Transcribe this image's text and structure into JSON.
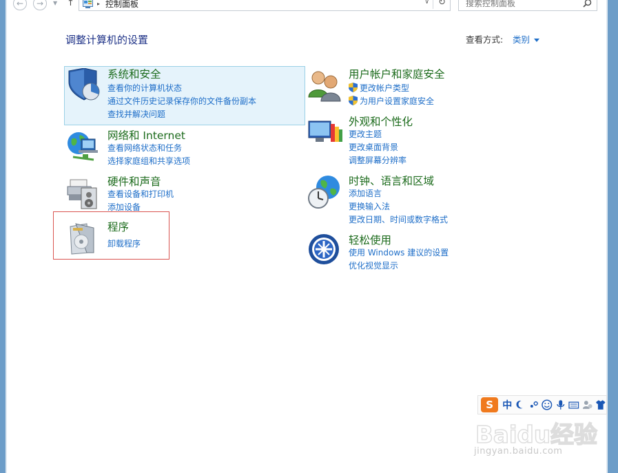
{
  "address_bar": {
    "back_glyph": "←",
    "forward_glyph": "→",
    "up_glyph": "↑",
    "separator_glyph": "▸",
    "path": "控制面板",
    "refresh_glyph": "↻"
  },
  "search": {
    "placeholder": "搜索控制面板"
  },
  "header": {
    "title": "调整计算机的设置",
    "view_by_label": "查看方式:",
    "view_by_value": "类别"
  },
  "categories": [
    {
      "title": "系统和安全",
      "links": [
        "查看你的计算机状态",
        "通过文件历史记录保存你的文件备份副本",
        "查找并解决问题"
      ]
    },
    {
      "title": "网络和 Internet",
      "links": [
        "查看网络状态和任务",
        "选择家庭组和共享选项"
      ]
    },
    {
      "title": "硬件和声音",
      "links": [
        "查看设备和打印机",
        "添加设备"
      ]
    },
    {
      "title": "程序",
      "links": [
        "卸载程序"
      ]
    },
    {
      "title": "用户帐户和家庭安全",
      "links": [
        "更改帐户类型",
        "为用户设置家庭安全"
      ]
    },
    {
      "title": "外观和个性化",
      "links": [
        "更改主题",
        "更改桌面背景",
        "调整屏幕分辨率"
      ]
    },
    {
      "title": "时钟、语言和区域",
      "links": [
        "添加语言",
        "更换输入法",
        "更改日期、时间或数字格式"
      ]
    },
    {
      "title": "轻松使用",
      "links": [
        "使用 Windows 建议的设置",
        "优化视觉显示"
      ]
    }
  ],
  "ime": {
    "logo": "S",
    "mode": "中"
  },
  "watermark": {
    "brand": "Baidu经验",
    "url": "jingyan.baidu.com"
  },
  "colors": {
    "title_green": "#1c6b1c",
    "link_blue": "#1e6ec8",
    "header_blue": "#1e3287",
    "selection_bg": "#e5f3fb",
    "highlight_red": "#d9534f"
  }
}
